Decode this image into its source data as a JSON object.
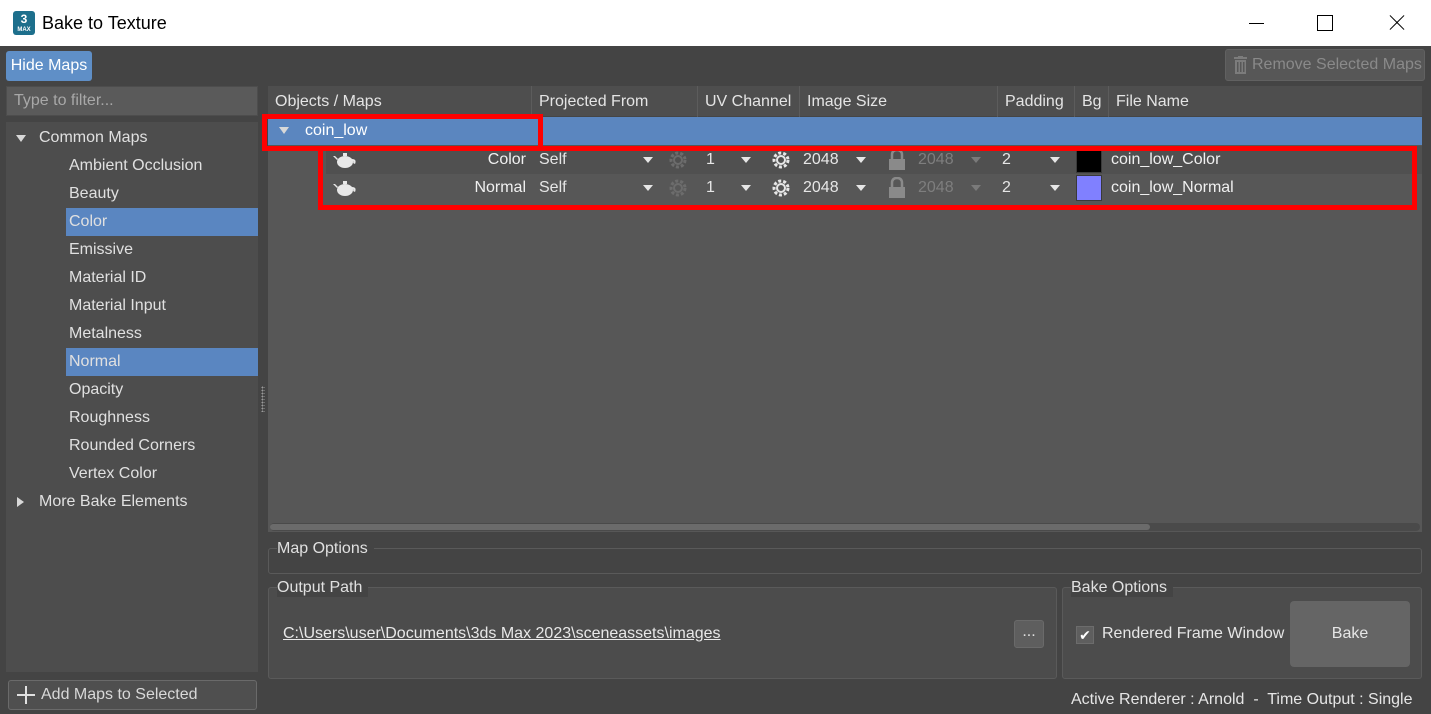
{
  "window": {
    "title": "Bake to Texture",
    "icon_text": "3",
    "icon_sub": "MAX"
  },
  "toolbar": {
    "hide_maps_label": "Hide Maps",
    "remove_selected_label": "Remove Selected Maps"
  },
  "filter": {
    "placeholder": "Type to filter..."
  },
  "tree": {
    "common_maps": "Common Maps",
    "items": [
      "Ambient Occlusion",
      "Beauty",
      "Color",
      "Emissive",
      "Material ID",
      "Material Input",
      "Metalness",
      "Normal",
      "Opacity",
      "Roughness",
      "Rounded Corners",
      "Vertex Color"
    ],
    "selected": [
      "Color",
      "Normal"
    ],
    "more_elements": "More Bake Elements"
  },
  "add_maps_label": "Add Maps to Selected Objects",
  "table": {
    "headers": [
      "Objects / Maps",
      "Projected From",
      "UV Channel",
      "Image Size",
      "Padding",
      "Bg",
      "File Name"
    ],
    "object_name": "coin_low",
    "rows": [
      {
        "map": "Color",
        "projected_from": "Self",
        "uv_channel": "1",
        "image_size": "2048",
        "image_size_locked": "2048",
        "padding": "2",
        "bg_color": "#000000",
        "file_name": "coin_low_Color"
      },
      {
        "map": "Normal",
        "projected_from": "Self",
        "uv_channel": "1",
        "image_size": "2048",
        "image_size_locked": "2048",
        "padding": "2",
        "bg_color": "#8080ff",
        "file_name": "coin_low_Normal"
      }
    ]
  },
  "map_options": {
    "title": "Map Options"
  },
  "output_path": {
    "title": "Output Path",
    "path": "C:\\Users\\user\\Documents\\3ds Max 2023\\sceneassets\\images",
    "browse_label": "..."
  },
  "bake_options": {
    "title": "Bake Options",
    "rendered_frame_window": "Rendered Frame Window",
    "rendered_frame_window_checked": true,
    "check_glyph": "✔",
    "bake_label": "Bake"
  },
  "status": "Active Renderer : Arnold  -  Time Output : Single",
  "colors": {
    "accent": "#5b86bf",
    "highlight": "#ff0000",
    "background": "#444444"
  }
}
